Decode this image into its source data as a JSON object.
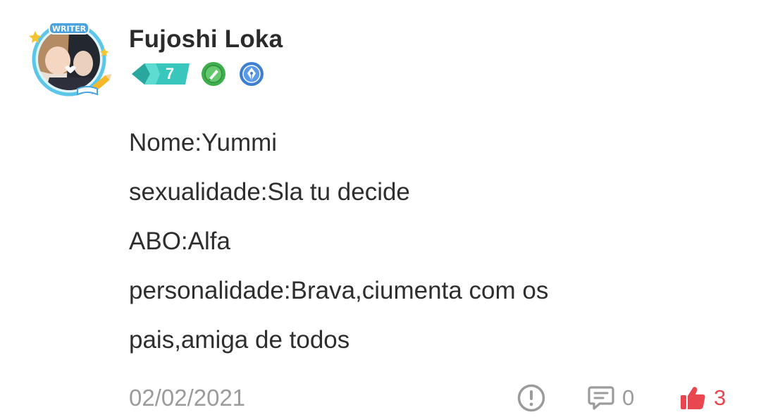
{
  "author": {
    "name": "Fujoshi Loka",
    "avatar_frame_label": "WRITER",
    "level": "7"
  },
  "badges": [
    {
      "icon": "green-quill-badge-icon",
      "color": "#3fae4d"
    },
    {
      "icon": "blue-pen-nib-badge-icon",
      "color": "#3f7fd1"
    }
  ],
  "content": {
    "lines": [
      "Nome:Yummi",
      "sexualidade:Sla tu decide",
      "ABO:Alfa",
      "personalidade:Brava,ciumenta com os",
      "pais,amiga de todos"
    ]
  },
  "footer": {
    "date": "02/02/2021",
    "report_icon": "exclamation-circle-icon",
    "reply_icon": "comment-bubble-icon",
    "reply_count": "0",
    "like_icon": "thumbs-up-icon",
    "like_count": "3"
  },
  "colors": {
    "text": "#2e2e2e",
    "muted": "#9b9b9b",
    "like": "#e8474f",
    "level_badge": "#3ec9c0"
  }
}
